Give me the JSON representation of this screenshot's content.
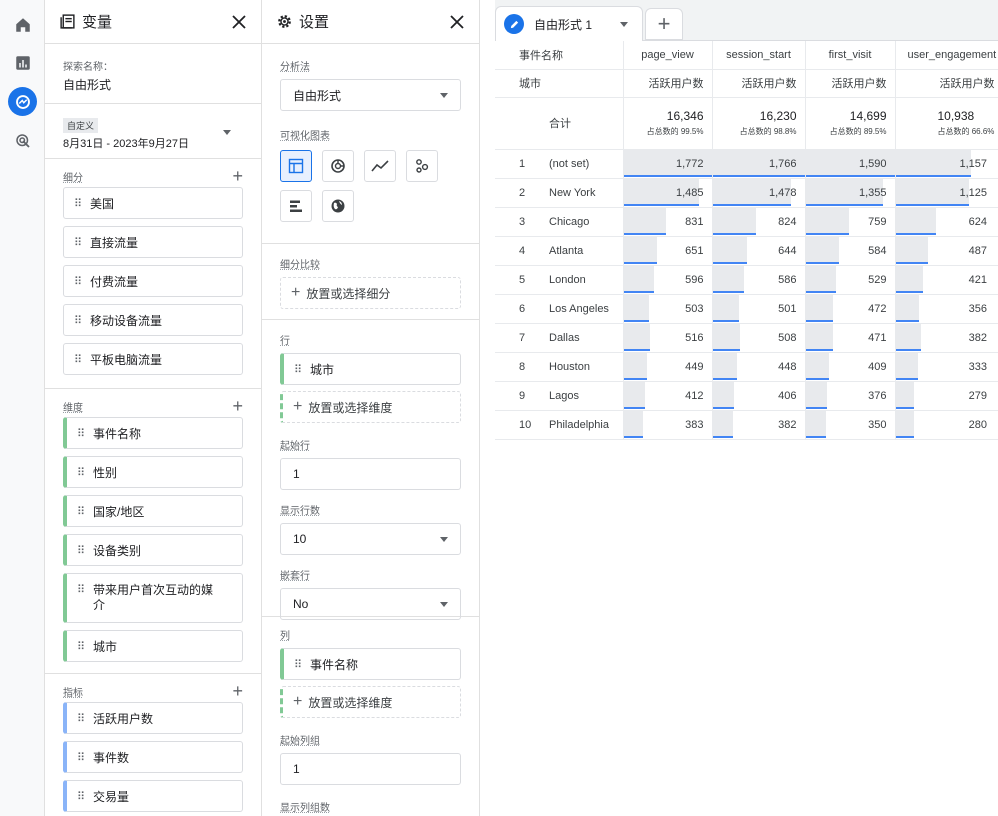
{
  "variables_panel": {
    "title": "变量",
    "exploration_name_label": "探索名称：",
    "exploration_name": "自由形式",
    "date_badge": "自定义",
    "date_range": "8月31日 - 2023年9月27日",
    "segments_label": "细分",
    "segments": [
      "美国",
      "直接流量",
      "付费流量",
      "移动设备流量",
      "平板电脑流量"
    ],
    "dimensions_label": "维度",
    "dimensions": [
      "事件名称",
      "性别",
      "国家/地区",
      "设备类别",
      "带来用户首次互动的媒介",
      "城市"
    ],
    "metrics_label": "指标",
    "metrics": [
      "活跃用户数",
      "事件数",
      "交易量"
    ]
  },
  "settings_panel": {
    "title": "设置",
    "technique_label": "分析法",
    "technique_value": "自由形式",
    "viz_label": "可视化图表",
    "viz_icons": [
      "table-icon",
      "donut-icon",
      "line-icon",
      "scatter-icon",
      "bar-icon",
      "globe-icon"
    ],
    "segment_compare_label": "细分比较",
    "segment_drop": "放置或选择细分",
    "rows_label": "行",
    "rows_item": "城市",
    "rows_drop": "放置或选择维度",
    "start_row_label": "起始行",
    "start_row_value": "1",
    "show_rows_label": "显示行数",
    "show_rows_value": "10",
    "nested_rows_label": "嵌套行",
    "nested_rows_value": "No",
    "columns_label": "列",
    "columns_item": "事件名称",
    "columns_drop": "放置或选择维度",
    "start_col_label": "起始列组",
    "start_col_value": "1",
    "show_col_label": "显示列组数"
  },
  "tab": {
    "name": "自由形式 1",
    "add": "+"
  },
  "table": {
    "dim_col_label": "事件名称",
    "row_dim_label": "城市",
    "metric_label": "活跃用户数",
    "columns": [
      "page_view",
      "session_start",
      "first_visit",
      "user_engagement"
    ],
    "total_label": "合计",
    "totals": [
      "16,346",
      "16,230",
      "14,699",
      "10,938"
    ],
    "total_pcts": [
      "占总数的 99.5%",
      "占总数的 98.8%",
      "占总数的 89.5%",
      "占总数的 66.6%"
    ],
    "rows": [
      {
        "idx": "1",
        "city": "(not set)",
        "values": [
          "1,772",
          "1,766",
          "1,590",
          "1,157"
        ],
        "fracs": [
          1.0,
          1.0,
          1.0,
          1.0
        ]
      },
      {
        "idx": "2",
        "city": "New York",
        "values": [
          "1,485",
          "1,478",
          "1,355",
          "1,125"
        ],
        "fracs": [
          0.838,
          0.837,
          0.852,
          0.972
        ]
      },
      {
        "idx": "3",
        "city": "Chicago",
        "values": [
          "831",
          "824",
          "759",
          "624"
        ],
        "fracs": [
          0.469,
          0.467,
          0.477,
          0.539
        ]
      },
      {
        "idx": "4",
        "city": "Atlanta",
        "values": [
          "651",
          "644",
          "584",
          "487"
        ],
        "fracs": [
          0.367,
          0.365,
          0.367,
          0.421
        ]
      },
      {
        "idx": "5",
        "city": "London",
        "values": [
          "596",
          "586",
          "529",
          "421"
        ],
        "fracs": [
          0.336,
          0.332,
          0.333,
          0.364
        ]
      },
      {
        "idx": "6",
        "city": "Los Angeles",
        "values": [
          "503",
          "501",
          "472",
          "356"
        ],
        "fracs": [
          0.284,
          0.284,
          0.297,
          0.308
        ]
      },
      {
        "idx": "7",
        "city": "Dallas",
        "values": [
          "516",
          "508",
          "471",
          "382"
        ],
        "fracs": [
          0.291,
          0.288,
          0.296,
          0.33
        ]
      },
      {
        "idx": "8",
        "city": "Houston",
        "values": [
          "449",
          "448",
          "409",
          "333"
        ],
        "fracs": [
          0.253,
          0.254,
          0.257,
          0.288
        ]
      },
      {
        "idx": "9",
        "city": "Lagos",
        "values": [
          "412",
          "406",
          "376",
          "279"
        ],
        "fracs": [
          0.233,
          0.23,
          0.236,
          0.241
        ]
      },
      {
        "idx": "10",
        "city": "Philadelphia",
        "values": [
          "383",
          "382",
          "350",
          "280"
        ],
        "fracs": [
          0.216,
          0.216,
          0.22,
          0.242
        ]
      }
    ]
  },
  "colors": {
    "accent": "#1a73e8",
    "dimension": "#81c995",
    "metric": "#8ab4f8",
    "bar": "#4285f4"
  }
}
